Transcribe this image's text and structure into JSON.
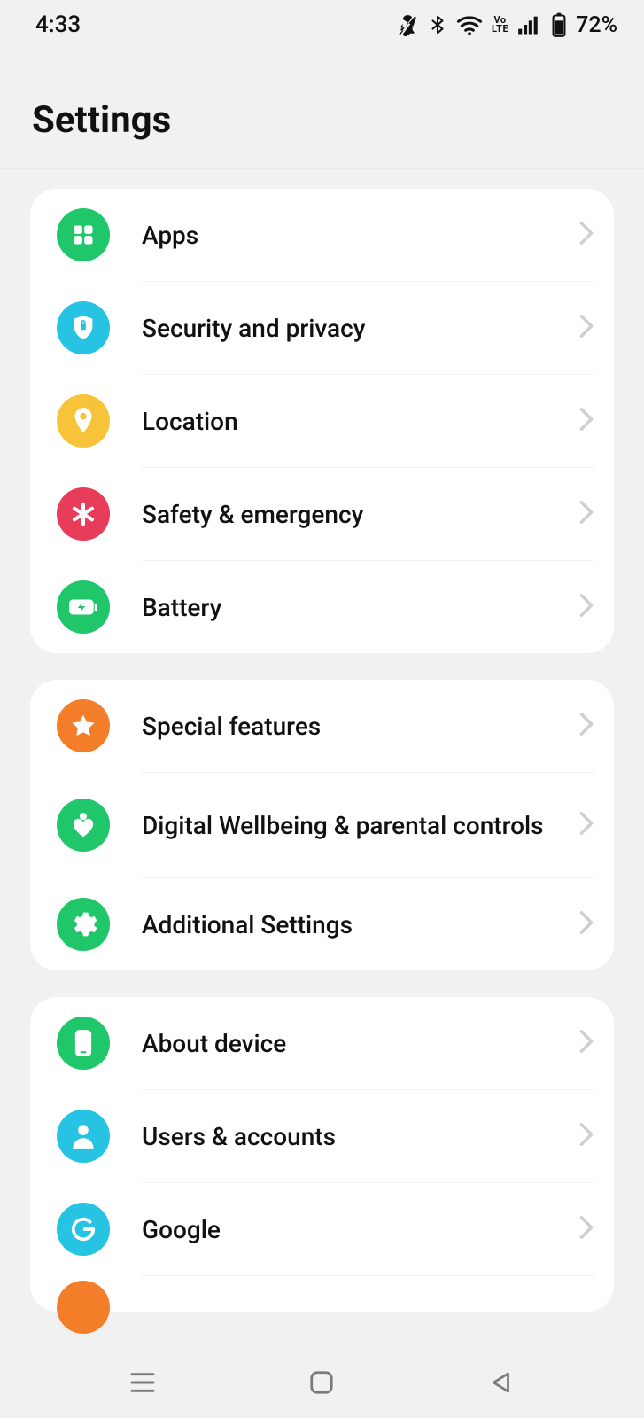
{
  "status": {
    "time": "4:33",
    "battery_text": "72%",
    "volte": "Vo\nLTE"
  },
  "page": {
    "title": "Settings"
  },
  "groups": [
    {
      "items": [
        {
          "id": "apps",
          "label": "Apps",
          "icon": "apps-icon",
          "color": "green"
        },
        {
          "id": "security",
          "label": "Security and privacy",
          "icon": "shield-icon",
          "color": "cyan"
        },
        {
          "id": "location",
          "label": "Location",
          "icon": "pin-icon",
          "color": "yellow"
        },
        {
          "id": "safety",
          "label": "Safety & emergency",
          "icon": "asterisk-icon",
          "color": "red"
        },
        {
          "id": "battery",
          "label": "Battery",
          "icon": "battery-icon",
          "color": "green"
        }
      ]
    },
    {
      "items": [
        {
          "id": "special",
          "label": "Special features",
          "icon": "star-icon",
          "color": "orange"
        },
        {
          "id": "wellbeing",
          "label": "Digital Wellbeing & parental controls",
          "icon": "heart-icon",
          "color": "green"
        },
        {
          "id": "additional",
          "label": "Additional Settings",
          "icon": "gear-icon",
          "color": "green"
        }
      ]
    },
    {
      "items": [
        {
          "id": "about",
          "label": "About device",
          "icon": "phone-icon",
          "color": "green"
        },
        {
          "id": "users",
          "label": "Users & accounts",
          "icon": "person-icon",
          "color": "cyan"
        },
        {
          "id": "google",
          "label": "Google",
          "icon": "google-g-icon",
          "color": "cyan"
        }
      ]
    }
  ]
}
